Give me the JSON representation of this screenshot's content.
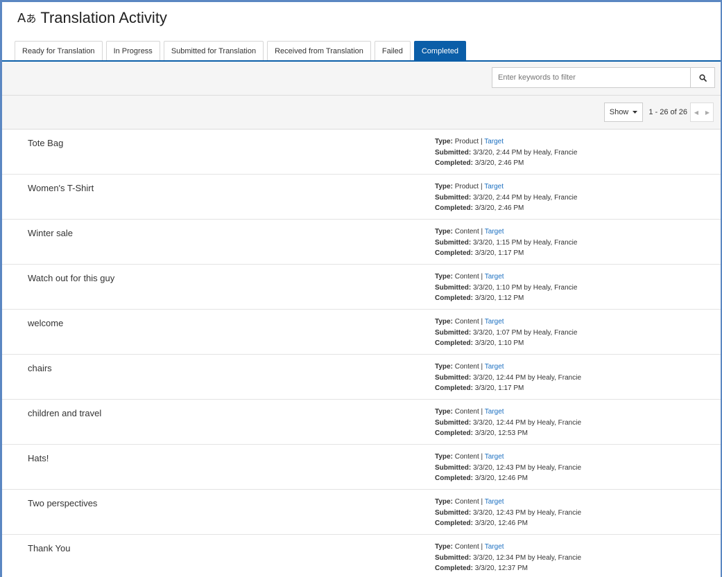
{
  "header": {
    "title": "Translation Activity",
    "icon": "translate-icon"
  },
  "tabs": [
    {
      "label": "Ready for Translation"
    },
    {
      "label": "In Progress"
    },
    {
      "label": "Submitted for Translation"
    },
    {
      "label": "Received from Translation"
    },
    {
      "label": "Failed"
    },
    {
      "label": "Completed",
      "active": true
    }
  ],
  "search": {
    "placeholder": "Enter keywords to filter",
    "value": ""
  },
  "pager": {
    "show_label": "Show",
    "count": "1 - 26 of 26"
  },
  "labels": {
    "type": "Type:",
    "submitted": "Submitted:",
    "completed": "Completed:",
    "target": "Target",
    "separator": "|"
  },
  "rows": [
    {
      "name": "Tote Bag",
      "type": "Product",
      "submitted": "3/3/20, 2:44 PM by Healy, Francie",
      "completed": "3/3/20, 2:46 PM"
    },
    {
      "name": "Women's T-Shirt",
      "type": "Product",
      "submitted": "3/3/20, 2:44 PM by Healy, Francie",
      "completed": "3/3/20, 2:46 PM"
    },
    {
      "name": "Winter sale",
      "type": "Content",
      "submitted": "3/3/20, 1:15 PM by Healy, Francie",
      "completed": "3/3/20, 1:17 PM"
    },
    {
      "name": "Watch out for this guy",
      "type": "Content",
      "submitted": "3/3/20, 1:10 PM by Healy, Francie",
      "completed": "3/3/20, 1:12 PM"
    },
    {
      "name": "welcome",
      "type": "Content",
      "submitted": "3/3/20, 1:07 PM by Healy, Francie",
      "completed": "3/3/20, 1:10 PM"
    },
    {
      "name": "chairs",
      "type": "Content",
      "submitted": "3/3/20, 12:44 PM by Healy, Francie",
      "completed": "3/3/20, 1:17 PM"
    },
    {
      "name": "children and travel",
      "type": "Content",
      "submitted": "3/3/20, 12:44 PM by Healy, Francie",
      "completed": "3/3/20, 12:53 PM"
    },
    {
      "name": "Hats!",
      "type": "Content",
      "submitted": "3/3/20, 12:43 PM by Healy, Francie",
      "completed": "3/3/20, 12:46 PM"
    },
    {
      "name": "Two perspectives",
      "type": "Content",
      "submitted": "3/3/20, 12:43 PM by Healy, Francie",
      "completed": "3/3/20, 12:46 PM"
    },
    {
      "name": "Thank You",
      "type": "Content",
      "submitted": "3/3/20, 12:34 PM by Healy, Francie",
      "completed": "3/3/20, 12:37 PM"
    }
  ],
  "colors": {
    "accent": "#0b5ea8",
    "link": "#1b6fc0",
    "frame": "#5b87c2"
  }
}
